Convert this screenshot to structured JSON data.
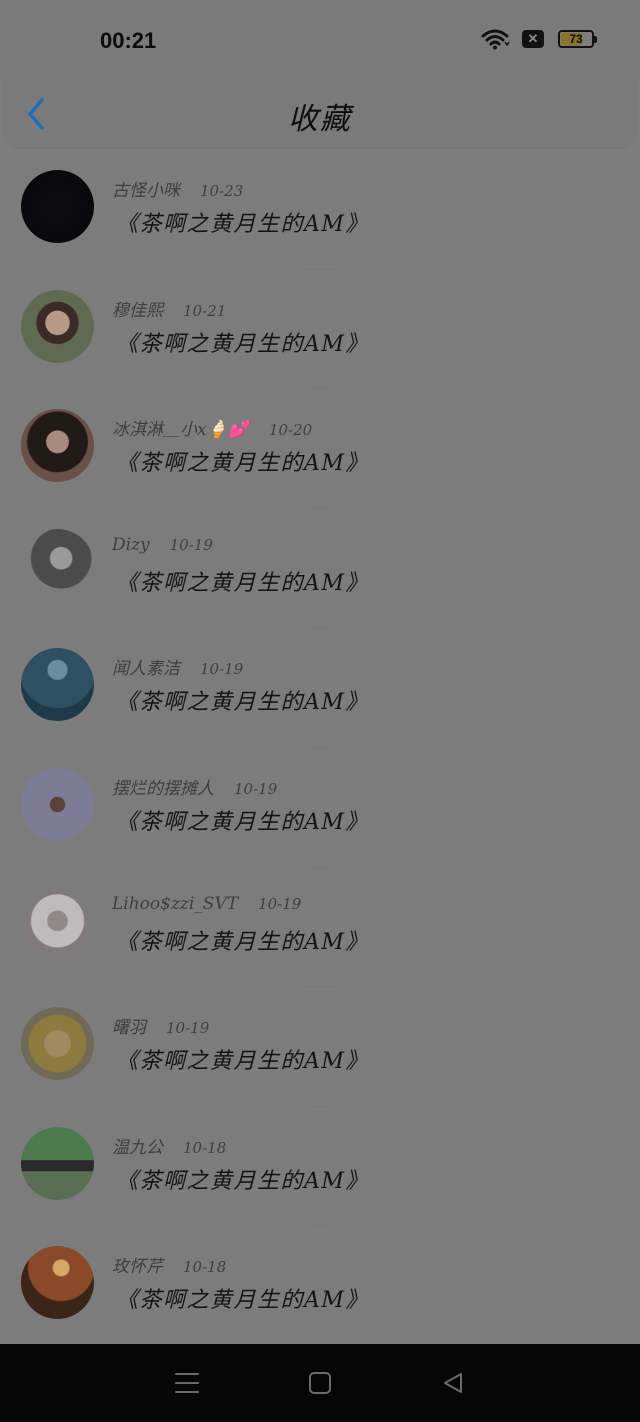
{
  "status_bar": {
    "time": "00:21",
    "battery_level": 73,
    "battery_text": "73",
    "icons": [
      "wifi-icon",
      "close-badge-icon",
      "battery-icon"
    ]
  },
  "header": {
    "title": "收藏",
    "back_icon": "chevron-left-icon",
    "accent": "#1e6fb3"
  },
  "favorites": [
    {
      "user": "古怪小咪",
      "date": "10-23",
      "title": "《茶啊之黄月生的AM》",
      "avatar": "avatar-dark-starfield"
    },
    {
      "user": "穆佳熙",
      "date": "10-21",
      "title": "《茶啊之黄月生的AM》",
      "avatar": "avatar-girl-flowers"
    },
    {
      "user": "冰淇淋＿小x🍦💕",
      "date": "10-20",
      "title": "《茶啊之黄月生的AM》",
      "avatar": "avatar-girl-dark-hair"
    },
    {
      "user": "Dizy",
      "date": "10-19",
      "title": "《茶啊之黄月生的AM》",
      "avatar": "avatar-grey-hair"
    },
    {
      "user": "闻人素洁",
      "date": "10-19",
      "title": "《茶啊之黄月生的AM》",
      "avatar": "avatar-tree-moon"
    },
    {
      "user": "摆烂的摆摊人",
      "date": "10-19",
      "title": "《茶啊之黄月生的AM》",
      "avatar": "avatar-bear-pillow"
    },
    {
      "user": "Lihoo$zzi_SVT",
      "date": "10-19",
      "title": "《茶啊之黄月生的AM》",
      "avatar": "avatar-white-hair-girl"
    },
    {
      "user": "曙羽",
      "date": "10-19",
      "title": "《茶啊之黄月生的AM》",
      "avatar": "avatar-anime-blonde"
    },
    {
      "user": "温九公",
      "date": "10-18",
      "title": "《茶啊之黄月生的AM》",
      "avatar": "avatar-anime-duo"
    },
    {
      "user": "玫怀芹",
      "date": "10-18",
      "title": "《茶啊之黄月生的AM》",
      "avatar": "avatar-sunset"
    }
  ],
  "nav_bar": {
    "buttons": [
      "menu-icon",
      "home-square-icon",
      "back-triangle-icon"
    ]
  }
}
